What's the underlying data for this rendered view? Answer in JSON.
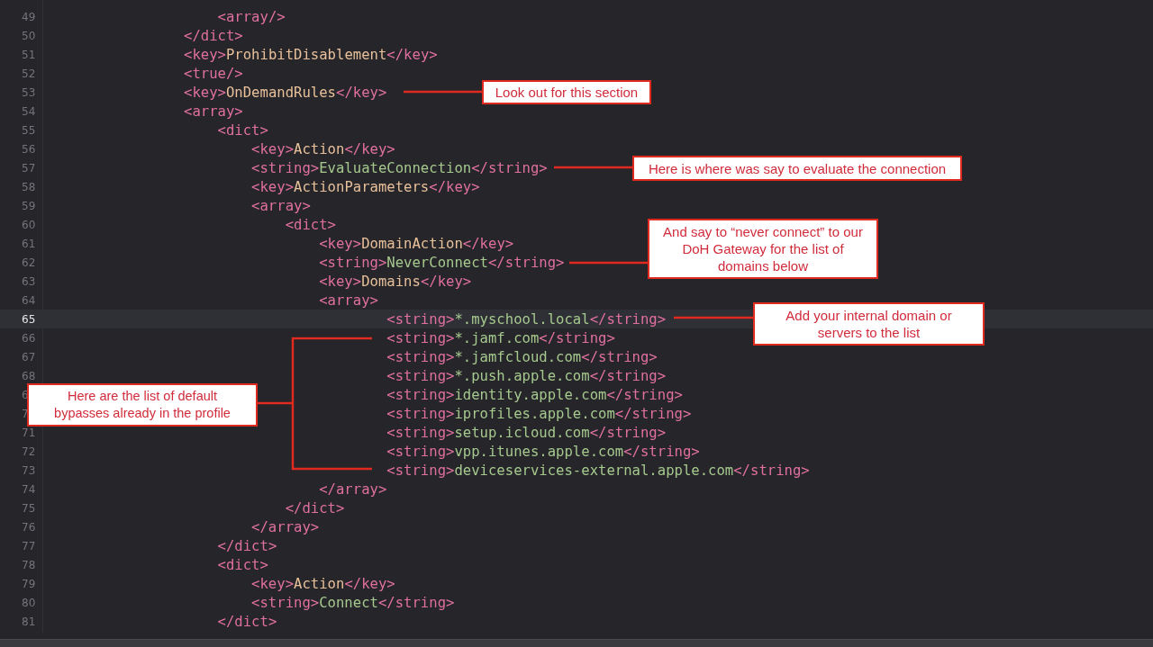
{
  "editor": {
    "lines": [
      {
        "children": [
          {
            "number": "49",
            "selected": false,
            "parts": [
              {
                "kind": "tag",
                "text": "<array/>"
              }
            ]
          }
        ]
      },
      {
        "number": "50",
        "selected": false,
        "parts": [
          {
            "kind": "tag",
            "text": "</dict>"
          }
        ]
      },
      {
        "number": "51",
        "selected": false,
        "parts": [
          {
            "kind": "tag",
            "text": "<key>"
          },
          {
            "kind": "key",
            "text": "ProhibitDisablement"
          },
          {
            "kind": "tag",
            "text": "</key>"
          }
        ]
      },
      {
        "number": "52",
        "selected": false,
        "parts": [
          {
            "kind": "tag",
            "text": "<true/>"
          }
        ]
      },
      {
        "number": "53",
        "selected": false,
        "parts": [
          {
            "kind": "tag",
            "text": "<key>"
          },
          {
            "kind": "key",
            "text": "OnDemandRules"
          },
          {
            "kind": "tag",
            "text": "</key>"
          }
        ]
      },
      {
        "number": "54",
        "selected": false,
        "parts": [
          {
            "kind": "tag",
            "text": "<array>"
          }
        ],
        "children": [
          {
            "number": "55",
            "selected": false,
            "parts": [
              {
                "kind": "tag",
                "text": "<dict>"
              }
            ],
            "children": [
              {
                "number": "56",
                "selected": false,
                "parts": [
                  {
                    "kind": "tag",
                    "text": "<key>"
                  },
                  {
                    "kind": "key",
                    "text": "Action"
                  },
                  {
                    "kind": "tag",
                    "text": "</key>"
                  }
                ]
              },
              {
                "number": "57",
                "selected": false,
                "parts": [
                  {
                    "kind": "tag",
                    "text": "<string>"
                  },
                  {
                    "kind": "value",
                    "text": "EvaluateConnection"
                  },
                  {
                    "kind": "tag",
                    "text": "</string>"
                  }
                ]
              },
              {
                "number": "58",
                "selected": false,
                "parts": [
                  {
                    "kind": "tag",
                    "text": "<key>"
                  },
                  {
                    "kind": "key",
                    "text": "ActionParameters"
                  },
                  {
                    "kind": "tag",
                    "text": "</key>"
                  }
                ]
              },
              {
                "number": "59",
                "selected": false,
                "parts": [
                  {
                    "kind": "tag",
                    "text": "<array>"
                  }
                ],
                "children": [
                  {
                    "number": "60",
                    "selected": false,
                    "parts": [
                      {
                        "kind": "tag",
                        "text": "<dict>"
                      }
                    ],
                    "children": [
                      {
                        "number": "61",
                        "selected": false,
                        "parts": [
                          {
                            "kind": "tag",
                            "text": "<key>"
                          },
                          {
                            "kind": "key",
                            "text": "DomainAction"
                          },
                          {
                            "kind": "tag",
                            "text": "</key>"
                          }
                        ]
                      },
                      {
                        "number": "62",
                        "selected": false,
                        "parts": [
                          {
                            "kind": "tag",
                            "text": "<string>"
                          },
                          {
                            "kind": "value",
                            "text": "NeverConnect"
                          },
                          {
                            "kind": "tag",
                            "text": "</string>"
                          }
                        ]
                      },
                      {
                        "number": "63",
                        "selected": false,
                        "parts": [
                          {
                            "kind": "tag",
                            "text": "<key>"
                          },
                          {
                            "kind": "key",
                            "text": "Domains"
                          },
                          {
                            "kind": "tag",
                            "text": "</key>"
                          }
                        ]
                      },
                      {
                        "number": "64",
                        "selected": false,
                        "parts": [
                          {
                            "kind": "tag",
                            "text": "<array>"
                          }
                        ],
                        "children": [
                          {
                            "children": [
                              {
                                "number": "65",
                                "selected": true,
                                "parts": [
                                  {
                                    "kind": "tag",
                                    "text": "<string>"
                                  },
                                  {
                                    "kind": "value",
                                    "text": "*.myschool.local"
                                  },
                                  {
                                    "kind": "tag",
                                    "text": "</string>"
                                  }
                                ]
                              },
                              {
                                "number": "66",
                                "selected": false,
                                "parts": [
                                  {
                                    "kind": "tag",
                                    "text": "<string>"
                                  },
                                  {
                                    "kind": "value",
                                    "text": "*.jamf.com"
                                  },
                                  {
                                    "kind": "tag",
                                    "text": "</string>"
                                  }
                                ]
                              },
                              {
                                "number": "67",
                                "selected": false,
                                "parts": [
                                  {
                                    "kind": "tag",
                                    "text": "<string>"
                                  },
                                  {
                                    "kind": "value",
                                    "text": "*.jamfcloud.com"
                                  },
                                  {
                                    "kind": "tag",
                                    "text": "</string>"
                                  }
                                ]
                              },
                              {
                                "number": "68",
                                "selected": false,
                                "parts": [
                                  {
                                    "kind": "tag",
                                    "text": "<string>"
                                  },
                                  {
                                    "kind": "value",
                                    "text": "*.push.apple.com"
                                  },
                                  {
                                    "kind": "tag",
                                    "text": "</string>"
                                  }
                                ]
                              },
                              {
                                "number": "6",
                                "selected": false,
                                "parts": [
                                  {
                                    "kind": "tag",
                                    "text": "<string>"
                                  },
                                  {
                                    "kind": "value",
                                    "text": "identity.apple.com"
                                  },
                                  {
                                    "kind": "tag",
                                    "text": "</string>"
                                  }
                                ]
                              },
                              {
                                "number": "7",
                                "selected": false,
                                "parts": [
                                  {
                                    "kind": "tag",
                                    "text": "<string>"
                                  },
                                  {
                                    "kind": "value",
                                    "text": "iprofiles.apple.com"
                                  },
                                  {
                                    "kind": "tag",
                                    "text": "</string>"
                                  }
                                ]
                              },
                              {
                                "number": "71",
                                "selected": false,
                                "parts": [
                                  {
                                    "kind": "tag",
                                    "text": "<string>"
                                  },
                                  {
                                    "kind": "value",
                                    "text": "setup.icloud.com"
                                  },
                                  {
                                    "kind": "tag",
                                    "text": "</string>"
                                  }
                                ]
                              },
                              {
                                "number": "72",
                                "selected": false,
                                "parts": [
                                  {
                                    "kind": "tag",
                                    "text": "<string>"
                                  },
                                  {
                                    "kind": "value",
                                    "text": "vpp.itunes.apple.com"
                                  },
                                  {
                                    "kind": "tag",
                                    "text": "</string>"
                                  }
                                ]
                              },
                              {
                                "number": "73",
                                "selected": false,
                                "parts": [
                                  {
                                    "kind": "tag",
                                    "text": "<string>"
                                  },
                                  {
                                    "kind": "value",
                                    "text": "deviceservices-external.apple.com"
                                  },
                                  {
                                    "kind": "tag",
                                    "text": "</string>"
                                  }
                                ]
                              }
                            ]
                          }
                        ]
                      },
                      {
                        "number": "74",
                        "selected": false,
                        "parts": [
                          {
                            "kind": "tag",
                            "text": "</array>"
                          }
                        ]
                      }
                    ]
                  },
                  {
                    "number": "75",
                    "selected": false,
                    "parts": [
                      {
                        "kind": "tag",
                        "text": "</dict>"
                      }
                    ]
                  }
                ]
              },
              {
                "number": "76",
                "selected": false,
                "parts": [
                  {
                    "kind": "tag",
                    "text": "</array>"
                  }
                ]
              }
            ]
          },
          {
            "number": "77",
            "selected": false,
            "parts": [
              {
                "kind": "tag",
                "text": "</dict>"
              }
            ]
          },
          {
            "number": "78",
            "selected": false,
            "parts": [
              {
                "kind": "tag",
                "text": "<dict>"
              }
            ],
            "children": [
              {
                "number": "79",
                "selected": false,
                "parts": [
                  {
                    "kind": "tag",
                    "text": "<key>"
                  },
                  {
                    "kind": "key",
                    "text": "Action"
                  },
                  {
                    "kind": "tag",
                    "text": "</key>"
                  }
                ]
              },
              {
                "number": "80",
                "selected": false,
                "parts": [
                  {
                    "kind": "tag",
                    "text": "<string>"
                  },
                  {
                    "kind": "value",
                    "text": "Connect"
                  },
                  {
                    "kind": "tag",
                    "text": "</string>"
                  }
                ]
              }
            ]
          },
          {
            "number": "81",
            "selected": false,
            "parts": [
              {
                "kind": "tag",
                "text": "</dict>"
              }
            ]
          }
        ]
      }
    ]
  },
  "annotations": [
    {
      "text": "Look out for this section"
    },
    {
      "text": "Here is where was say to evaluate the connection"
    },
    {
      "text": "And say to “never connect” to our DoH Gateway for the list of domains below"
    },
    {
      "text": "Add your internal domain or servers to the list"
    },
    {
      "text": "Here are the list of default bypasses already in the profile"
    }
  ]
}
